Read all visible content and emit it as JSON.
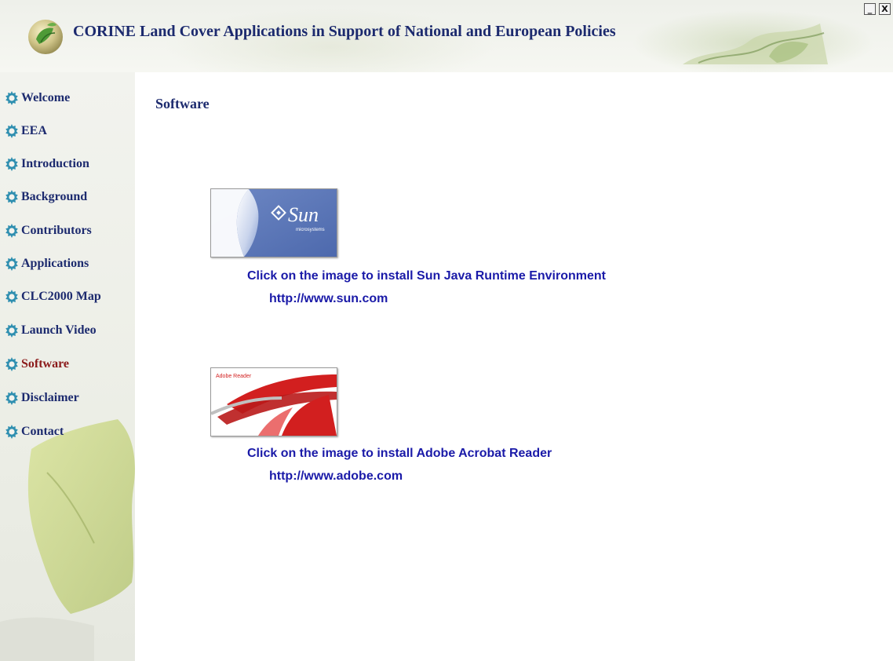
{
  "header": {
    "title": "CORINE Land Cover Applications in Support of National and European Policies",
    "logo_icon": "globe-leaf-icon",
    "window_controls": {
      "minimize": "_",
      "close": "X"
    }
  },
  "sidebar": {
    "items": [
      {
        "label": "Welcome",
        "icon": "gear-icon",
        "active": false
      },
      {
        "label": "EEA",
        "icon": "gear-icon",
        "active": false
      },
      {
        "label": "Introduction",
        "icon": "gear-icon",
        "active": false
      },
      {
        "label": "Background",
        "icon": "gear-icon",
        "active": false
      },
      {
        "label": "Contributors",
        "icon": "gear-icon",
        "active": false
      },
      {
        "label": "Applications",
        "icon": "gear-icon",
        "active": false
      },
      {
        "label": "CLC2000 Map",
        "icon": "gear-icon",
        "active": false
      },
      {
        "label": "Launch Video",
        "icon": "gear-icon",
        "active": false
      },
      {
        "label": "Software",
        "icon": "gear-icon",
        "active": true
      },
      {
        "label": "Disclaimer",
        "icon": "gear-icon",
        "active": false
      },
      {
        "label": "Contact",
        "icon": "gear-icon",
        "active": false
      }
    ]
  },
  "main": {
    "title": "Software",
    "software": [
      {
        "image_logo_text": "Sun",
        "image_subtext": "microsystems",
        "caption": "Click on the image to install Sun Java Runtime Environment",
        "link": "http://www.sun.com"
      },
      {
        "image_logo_text": "Adobe Reader",
        "caption": "Click on the image to install Adobe Acrobat Reader",
        "link": "http://www.adobe.com"
      }
    ]
  },
  "colors": {
    "nav_text": "#1c2a6e",
    "nav_active": "#8b1a1a",
    "caption_text": "#1a1aa8",
    "adobe_red": "#d21f1f",
    "sun_blue": "#5a76b8"
  }
}
